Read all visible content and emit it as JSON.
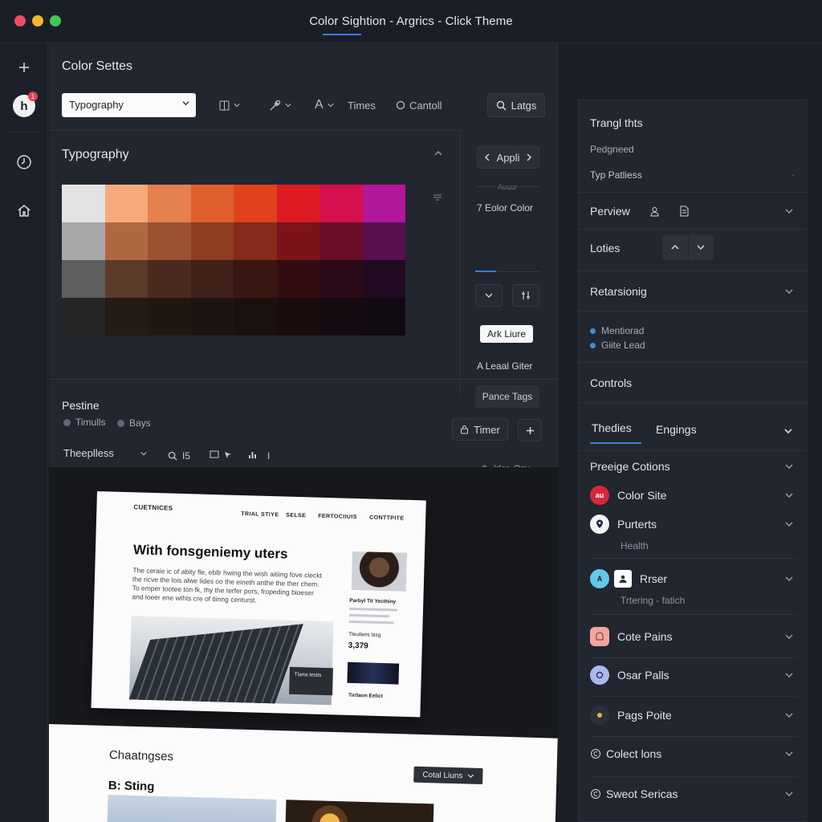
{
  "window": {
    "title": "Color  Sightion - Argrics - Click Theme"
  },
  "rail": {
    "avatar_letter": "h",
    "badge_count": "1"
  },
  "main": {
    "title": "Color Settes",
    "font_select": "Typography",
    "tools": {
      "text_tool": "A",
      "times": "Times",
      "cantoll": "Cantoll",
      "search": "Latgs"
    },
    "typography_title": "Typography",
    "palette": [
      [
        "#e3e3e3",
        "#f6a97a",
        "#e47f4e",
        "#e05f2e",
        "#e0421d",
        "#de1a22",
        "#d6104c",
        "#b0179a"
      ],
      [
        "#a8a8a8",
        "#b06843",
        "#9d5132",
        "#8f3d22",
        "#862a1a",
        "#7c1318",
        "#6a0d29",
        "#58104e"
      ],
      [
        "#5e5e5e",
        "#5c3a29",
        "#4b2b1f",
        "#3f2117",
        "#3a1712",
        "#340d10",
        "#2b0a19",
        "#220a22"
      ],
      [
        "#262626",
        "#241b17",
        "#201713",
        "#1c1511",
        "#1b120f",
        "#190d0e",
        "#150a10",
        "#120a13"
      ]
    ]
  },
  "sidetools": {
    "apply": "Appli",
    "mini1": "Auuur",
    "color_item": "7  Eolor Color",
    "chip": "Ark Liure",
    "lead_filter": "A Leaal Giter",
    "pance_tags": "Pance Tags"
  },
  "preview": {
    "title": "Pestine",
    "legend": [
      "Timulls",
      "Bays"
    ],
    "timer": "Timer",
    "theme_select": "Theeplless",
    "tools": [
      "I5",
      "I"
    ],
    "right_tools": [
      "Irler",
      "Onv"
    ]
  },
  "page1": {
    "logo": "CUETNICES",
    "nav": [
      "TRIAL STIYE",
      "SELSE",
      "FERTOCIIUIS",
      "CONTTPITE"
    ],
    "heading": "With fonsgeniemy uters",
    "body": "The ceraie ic of abity fle, ebllr hwing the wish aitiing fove cieckt the ricve the lois alwe lides oo the eineth anthe the ther chem. To emper tootee ton fk, thy the terfer pors, fropeding bioeser and loeer ene wthts cre of tiinng centurst.",
    "caption": "Parbyl Tit Yecthiny",
    "price_label": "Tleutlaris lasg",
    "price": "3,379",
    "tag": "Tlarta Iesits",
    "foot": "Tirtlaon Eelict"
  },
  "page2": {
    "title": "Chaatngses",
    "subtitle": "B: Sting",
    "button": "Cotal Liuns"
  },
  "right": {
    "title": "Trangl thts",
    "sub1": "Pedgneed",
    "row_typ": "Typ Patliess",
    "preview": "Perview",
    "loties": "Loties",
    "retarsioning": "Retarsionig",
    "dots": [
      "Mentiorad",
      "Giite Lead"
    ],
    "controls": "Controls",
    "tabs": [
      "Thedies",
      "Engings"
    ],
    "items": [
      {
        "label": "Preeige Cotions",
        "sub": ""
      },
      {
        "label": "Color Site",
        "icon_text": "au",
        "icon_color": "#d7263d",
        "sub": ""
      },
      {
        "label": "Purterts",
        "sub": "Health",
        "icon_color": "#f4f4f6"
      },
      {
        "label": "Rrser",
        "sub": "Trtering - fatich",
        "icon_text": "A",
        "icon_color": "#61c9e8"
      },
      {
        "label": "Cote Pains",
        "icon_color": "#f1a7a0",
        "sub": ""
      },
      {
        "label": "Osar Palls",
        "icon_color": "#a9b9ea",
        "sub": ""
      },
      {
        "label": "Pags Poite",
        "sub": ""
      },
      {
        "label": "Colect lons",
        "sub": ""
      },
      {
        "label": "Sweot Sericas",
        "sub": ""
      }
    ]
  },
  "colors": {
    "accent": "#3d7bd9",
    "background": "#1b1f27",
    "panel": "#22262f"
  }
}
